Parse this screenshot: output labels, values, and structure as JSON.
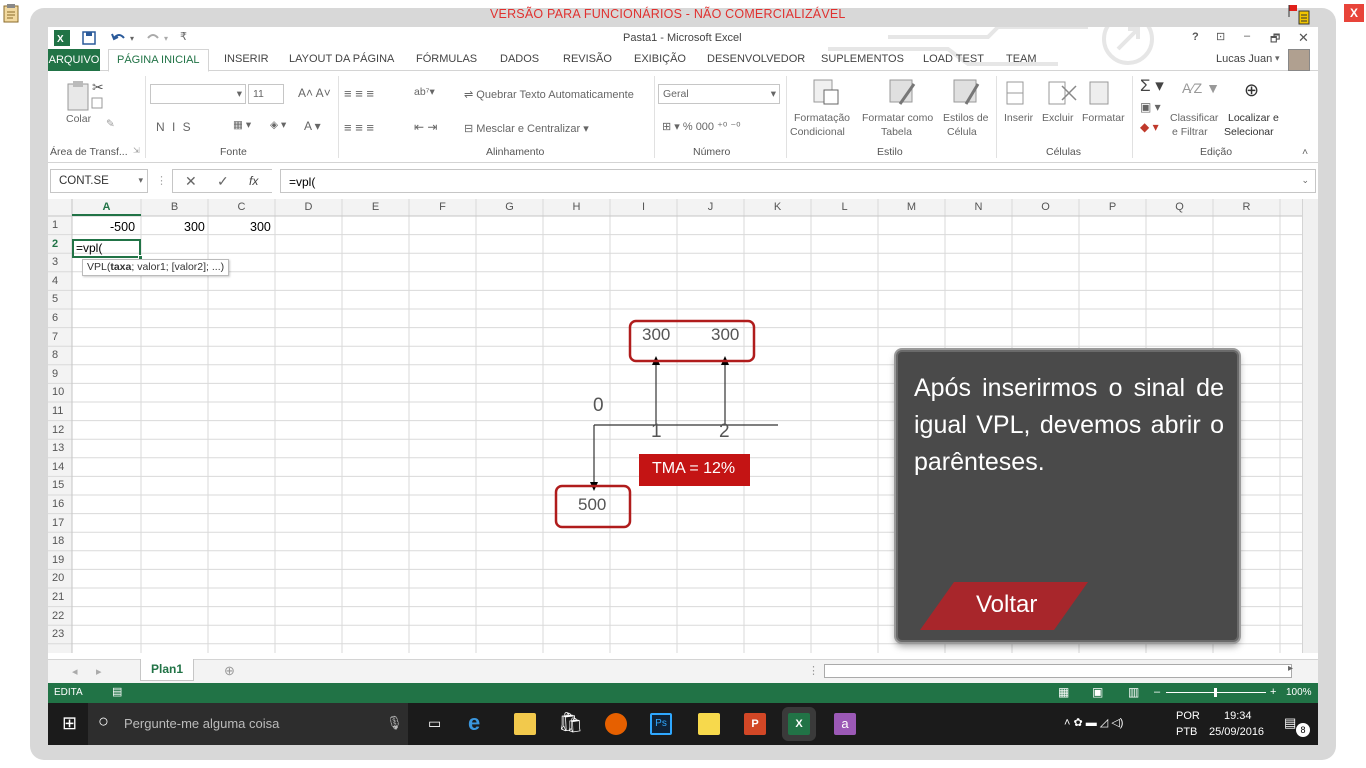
{
  "banner": "VERSÃO PARA FUNCIONÁRIOS - NÃO COMERCIALIZÁVEL",
  "corner_close": "X",
  "window_title": "Pasta1 - Microsoft Excel",
  "title_controls": [
    "?",
    "⊡",
    "–",
    "🗗",
    "✕"
  ],
  "tabs": [
    "ARQUIVO",
    "PÁGINA INICIAL",
    "INSERIR",
    "LAYOUT DA PÁGINA",
    "FÓRMULAS",
    "DADOS",
    "REVISÃO",
    "EXIBIÇÃO",
    "DESENVOLVEDOR",
    "SUPLEMENTOS",
    "LOAD TEST",
    "TEAM"
  ],
  "user": "Lucas Juan",
  "ribbon": {
    "colar": "Colar",
    "area_transf": "Área de Transf...",
    "font_size": "11",
    "fonte": "Fonte",
    "bold_italic_underline": "N  I  S",
    "quebrar": "Quebrar Texto Automaticamente",
    "mesclar": "Mesclar e Centralizar",
    "alinhamento": "Alinhamento",
    "numfmt": "Geral",
    "numero": "Número",
    "formatacao": "Formatação",
    "condicional": "Condicional",
    "formatar_como": "Formatar como",
    "tabela": "Tabela",
    "estilos_de": "Estilos de",
    "celula": "Célula",
    "estilo": "Estilo",
    "inserir": "Inserir",
    "excluir": "Excluir",
    "formatar": "Formatar",
    "celulas": "Células",
    "classificar": "Classificar",
    "e_filtrar": "e Filtrar",
    "localizar": "Localizar e",
    "selecionar": "Selecionar",
    "edicao": "Edição"
  },
  "formula_bar": {
    "name_box": "CONT.SE",
    "formula": "=vpl("
  },
  "columns": [
    "A",
    "B",
    "C",
    "D",
    "E",
    "F",
    "G",
    "H",
    "I",
    "J",
    "K",
    "L",
    "M",
    "N",
    "O",
    "P",
    "Q",
    "R"
  ],
  "rows": [
    "1",
    "2",
    "3",
    "4",
    "5",
    "6",
    "7",
    "8",
    "9",
    "10",
    "11",
    "12",
    "13",
    "14",
    "15",
    "16",
    "17",
    "18",
    "19",
    "20",
    "21",
    "22",
    "23"
  ],
  "cells": {
    "A1": "-500",
    "B1": "300",
    "C1": "300",
    "A2": "=vpl("
  },
  "tooltip": {
    "prefix": "VPL(",
    "bold": "taxa",
    "rest": "; valor1; [valor2]; ...)"
  },
  "diagram": {
    "top_left": "300",
    "top_right": "300",
    "zero": "0",
    "one": "1",
    "two": "2",
    "tma": "TMA = 12%",
    "bottom": "500"
  },
  "callout": {
    "text": "Após inserirmos o sinal de igual VPL, devemos abrir o parênteses.",
    "button": "Voltar"
  },
  "sheet_tab": "Plan1",
  "status": {
    "mode": "EDITA",
    "zoom": "100%"
  },
  "taskbar": {
    "search": "Pergunte-me alguma coisa",
    "lang1": "POR",
    "lang2": "PTB",
    "time": "19:34",
    "date": "25/09/2016",
    "notif": "8"
  },
  "colors": {
    "excel_green": "#217346",
    "diagram_red": "#b01c1c",
    "callout_bg": "#4a4a4a",
    "button_red": "#a8262b"
  }
}
